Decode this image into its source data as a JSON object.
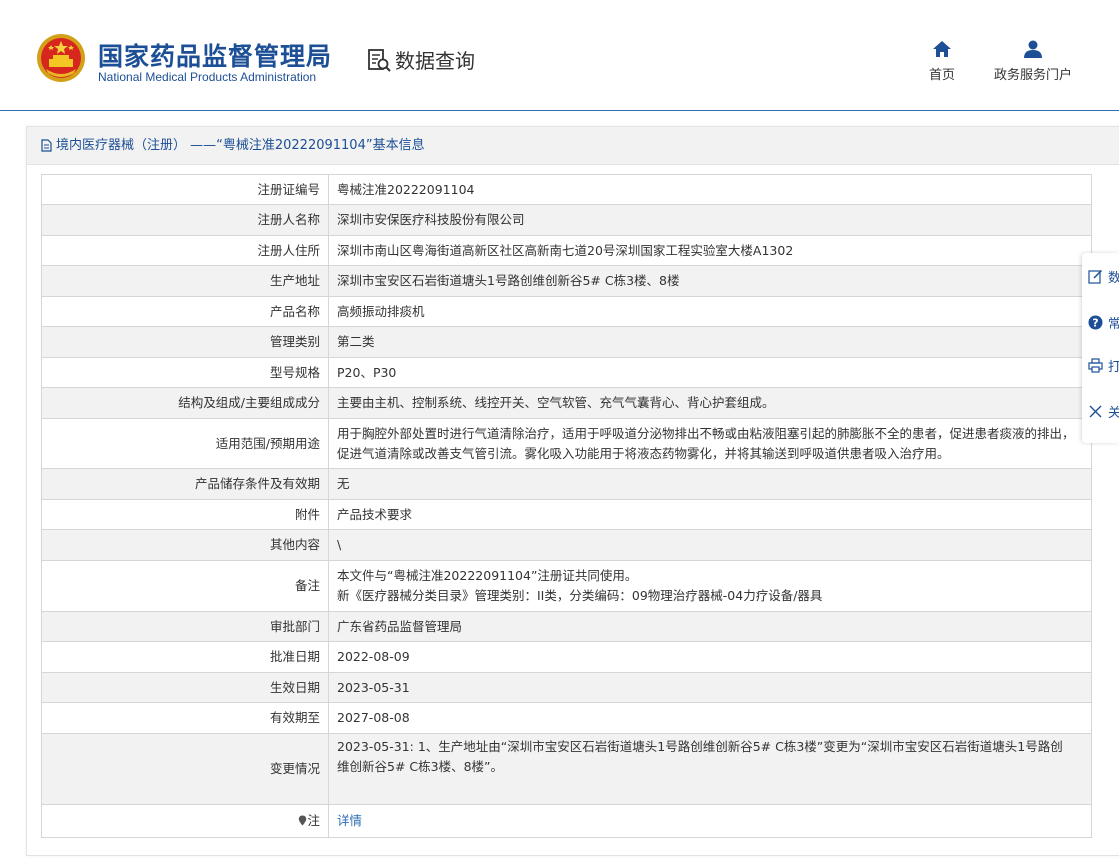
{
  "header": {
    "org_name_cn": "国家药品监督管理局",
    "org_name_en": "National Medical Products Administration",
    "data_query": "数据查询",
    "nav": [
      {
        "label": "首页",
        "icon": "home-icon"
      },
      {
        "label": "政务服务门户",
        "icon": "user-icon"
      }
    ]
  },
  "page": {
    "title": "境内医疗器械（注册） ——“粤械注准20222091104”基本信息"
  },
  "info": [
    {
      "key": "注册证编号",
      "value": "粤械注准20222091104"
    },
    {
      "key": "注册人名称",
      "value": "深圳市安保医疗科技股份有限公司"
    },
    {
      "key": "注册人住所",
      "value": "深圳市南山区粤海街道高新区社区高新南七道20号深圳国家工程实验室大楼A1302"
    },
    {
      "key": "生产地址",
      "value": "深圳市宝安区石岩街道塘头1号路创维创新谷5# C栋3楼、8楼"
    },
    {
      "key": "产品名称",
      "value": "高频振动排痰机"
    },
    {
      "key": "管理类别",
      "value": "第二类"
    },
    {
      "key": "型号规格",
      "value": "P20、P30"
    },
    {
      "key": "结构及组成/主要组成成分",
      "value": "主要由主机、控制系统、线控开关、空气软管、充气气囊背心、背心护套组成。"
    },
    {
      "key": "适用范围/预期用途",
      "value_lines": [
        "用于胸腔外部处置时进行气道清除治疗，适用于呼吸道分泌物排出不畅或由粘液阻塞引起的肺膨胀不全的患者，促进患者痰液的排出，",
        "促进气道清除或改善支气管引流。雾化吸入功能用于将液态药物雾化，并将其输送到呼吸道供患者吸入治疗用。"
      ]
    },
    {
      "key": "产品储存条件及有效期",
      "value": "无"
    },
    {
      "key": "附件",
      "value": "产品技术要求"
    },
    {
      "key": "其他内容",
      "value": "\\"
    },
    {
      "key": "备注",
      "value_lines": [
        "本文件与“粤械注准20222091104”注册证共同使用。",
        "新《医疗器械分类目录》管理类别：II类，分类编码：09物理治疗器械-04力疗设备/器具"
      ]
    },
    {
      "key": "审批部门",
      "value": "广东省药品监督管理局"
    },
    {
      "key": "批准日期",
      "value": "2022-08-09"
    },
    {
      "key": "生效日期",
      "value": "2023-05-31"
    },
    {
      "key": "有效期至",
      "value": "2027-08-08"
    },
    {
      "key": "变更情况",
      "value_lines": [
        "2023-05-31: 1、生产地址由“深圳市宝安区石岩街道塘头1号路创维创新谷5# C栋3楼”变更为“深圳市宝安区石岩街道塘头1号路创",
        "维创新谷5# C栋3楼、8楼”。"
      ]
    },
    {
      "key": "注",
      "value": "详情",
      "key_icon": "pin-icon"
    }
  ],
  "side_tools": [
    {
      "label": "数",
      "icon": "edit-icon"
    },
    {
      "label": "常",
      "icon": "question-icon"
    },
    {
      "label": "打",
      "icon": "print-icon"
    },
    {
      "label": "关",
      "icon": "close-icon"
    }
  ]
}
